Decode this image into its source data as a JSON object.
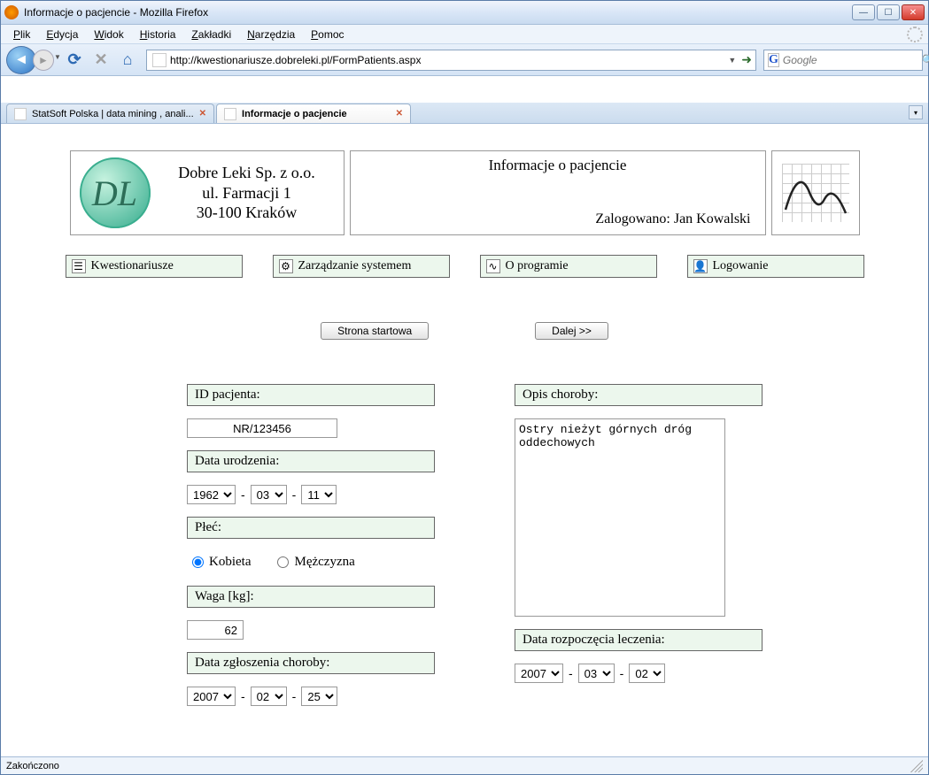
{
  "window": {
    "title": "Informacje o pacjencie - Mozilla Firefox"
  },
  "menu": {
    "items": [
      "Plik",
      "Edycja",
      "Widok",
      "Historia",
      "Zakładki",
      "Narzędzia",
      "Pomoc"
    ]
  },
  "url": "http://kwestionariusze.dobreleki.pl/FormPatients.aspx",
  "search_placeholder": "Google",
  "tabs": {
    "inactive": "StatSoft Polska | data mining , anali...",
    "active": "Informacje o pacjencie"
  },
  "header": {
    "company": "Dobre Leki Sp. z o.o.",
    "street": "ul. Farmacji 1",
    "city": "30-100 Kraków",
    "page_title": "Informacje o pacjencie",
    "login_label": "Zalogowano: Jan Kowalski"
  },
  "nav": {
    "questionnaires": "Kwestionariusze",
    "management": "Zarządzanie systemem",
    "about": "O programie",
    "login": "Logowanie"
  },
  "buttons": {
    "home": "Strona startowa",
    "next": "Dalej >>"
  },
  "form": {
    "patient_id_label": "ID pacjenta:",
    "patient_id": "NR/123456",
    "dob_label": "Data urodzenia:",
    "dob": {
      "year": "1962",
      "month": "03",
      "day": "11"
    },
    "sex_label": "Płeć:",
    "sex_female": "Kobieta",
    "sex_male": "Mężczyzna",
    "weight_label": "Waga [kg]:",
    "weight": "62",
    "report_date_label": "Data zgłoszenia choroby:",
    "report_date": {
      "year": "2007",
      "month": "02",
      "day": "25"
    },
    "desc_label": "Opis choroby:",
    "desc": "Ostry nieżyt górnych dróg oddechowych",
    "treat_date_label": "Data rozpoczęcia leczenia:",
    "treat_date": {
      "year": "2007",
      "month": "03",
      "day": "02"
    }
  },
  "status": "Zakończono"
}
